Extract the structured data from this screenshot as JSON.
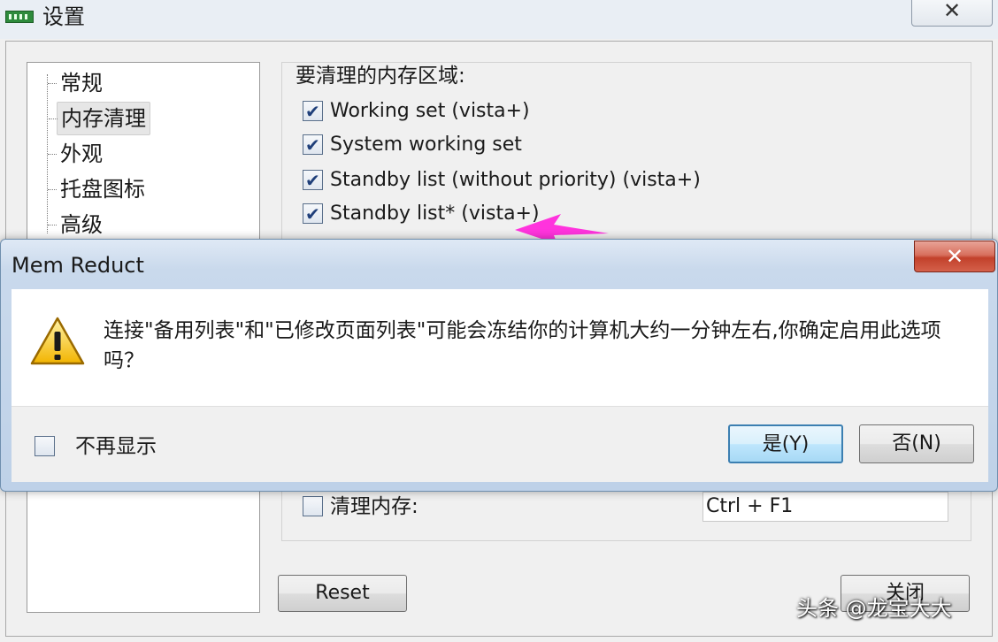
{
  "settings": {
    "title": "设置",
    "close_glyph": "✕",
    "tree_items": [
      "常规",
      "内存清理",
      "外观",
      "托盘图标",
      "高级"
    ],
    "group_title": "要清理的内存区域:",
    "checkboxes": [
      {
        "label": "Working set (vista+)",
        "checked": true
      },
      {
        "label": "System working set",
        "checked": true
      },
      {
        "label": "Standby list (without priority) (vista+)",
        "checked": true
      },
      {
        "label": "Standby list* (vista+)",
        "checked": true
      }
    ],
    "clean_memory_label": "清理内存:",
    "clean_memory_checked": false,
    "hotkey_value": "Ctrl + F1",
    "reset_label": "Reset",
    "close_label": "关闭"
  },
  "dialog": {
    "title": "Mem Reduct",
    "close_glyph": "✕",
    "message": "连接\"备用列表\"和\"已修改页面列表\"可能会冻结你的计算机大约一分钟左右,你确定启用此选项吗？",
    "dont_show_label": "不再显示",
    "dont_show_checked": false,
    "yes_label": "是(Y)",
    "no_label": "否(N)"
  },
  "watermark": "头条 @龙宝大大",
  "colors": {
    "arrow": "#ff33dd",
    "dialog_close": "#c2412b",
    "accent": "#3c7fb1"
  },
  "icons": {
    "app": "memory-chip-icon",
    "warning": "warning-triangle-icon"
  }
}
